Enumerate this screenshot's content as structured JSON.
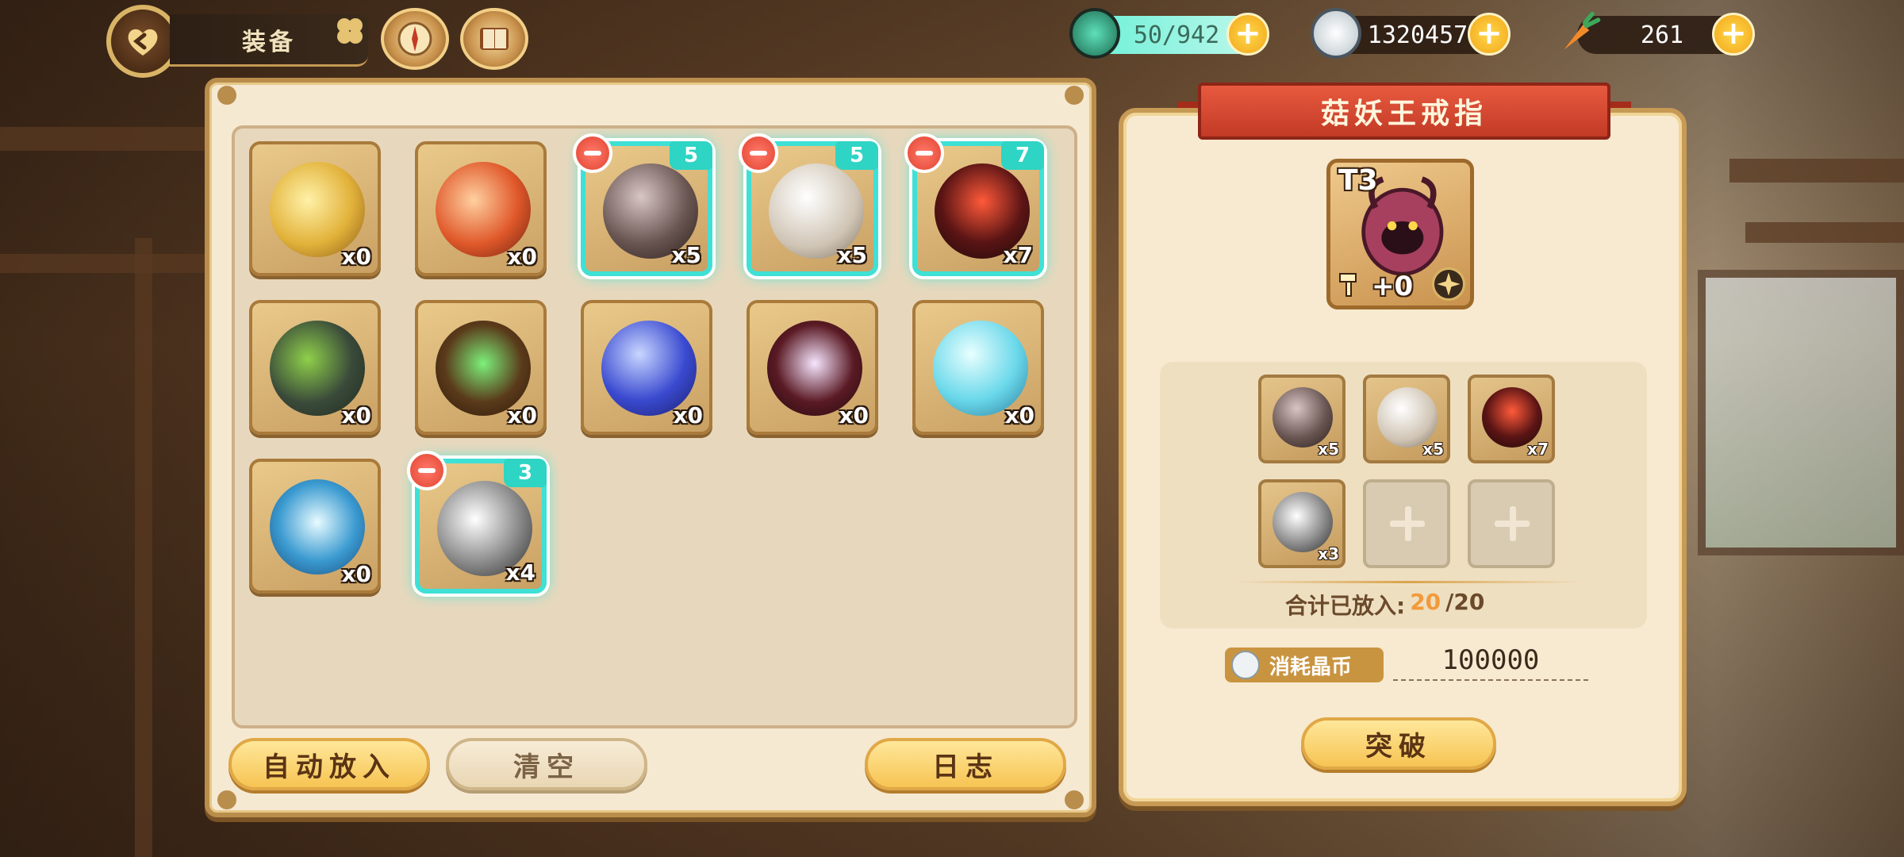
{
  "topbar": {
    "title": "装备",
    "resources": {
      "stamina": "50/942",
      "clover_coins": "1320457",
      "carrots": "261"
    }
  },
  "inventory": {
    "items": [
      {
        "name": "gold-ore",
        "qty": "x0",
        "badge": "",
        "selected": false
      },
      {
        "name": "fire-ore",
        "qty": "x0",
        "badge": "",
        "selected": false
      },
      {
        "name": "dark-orb",
        "qty": "x5",
        "badge": "5",
        "selected": true
      },
      {
        "name": "pale-orb",
        "qty": "x5",
        "badge": "5",
        "selected": true
      },
      {
        "name": "lava-core",
        "qty": "x7",
        "badge": "7",
        "selected": true
      },
      {
        "name": "moss-stone",
        "qty": "x0",
        "badge": "",
        "selected": false
      },
      {
        "name": "emerald-shell",
        "qty": "x0",
        "badge": "",
        "selected": false
      },
      {
        "name": "water-orb",
        "qty": "x0",
        "badge": "",
        "selected": false
      },
      {
        "name": "crimson-crystal",
        "qty": "x0",
        "badge": "",
        "selected": false
      },
      {
        "name": "ice-jelly",
        "qty": "x0",
        "badge": "",
        "selected": false
      },
      {
        "name": "frost-shard",
        "qty": "x0",
        "badge": "",
        "selected": false
      },
      {
        "name": "iron-ore",
        "qty": "x4",
        "badge": "3",
        "selected": true
      }
    ],
    "buttons": {
      "auto": "自动放入",
      "clear": "清空",
      "log": "日志"
    }
  },
  "detail": {
    "title": "菇妖王戒指",
    "tier": "T3",
    "level": "+0",
    "materials": [
      {
        "name": "dark-orb",
        "qty": "x5"
      },
      {
        "name": "pale-orb",
        "qty": "x5"
      },
      {
        "name": "lava-core",
        "qty": "x7"
      },
      {
        "name": "iron-ore",
        "qty": "x3"
      }
    ],
    "total_label": "合计已放入:",
    "total_current": "20",
    "total_max": "/20",
    "cost_label": "消耗晶币",
    "cost_value": "100000",
    "breakthrough": "突破"
  },
  "colors": {
    "accent": "#3fe0d5",
    "ribbon": "#d84a32",
    "button": "#f6c453"
  }
}
